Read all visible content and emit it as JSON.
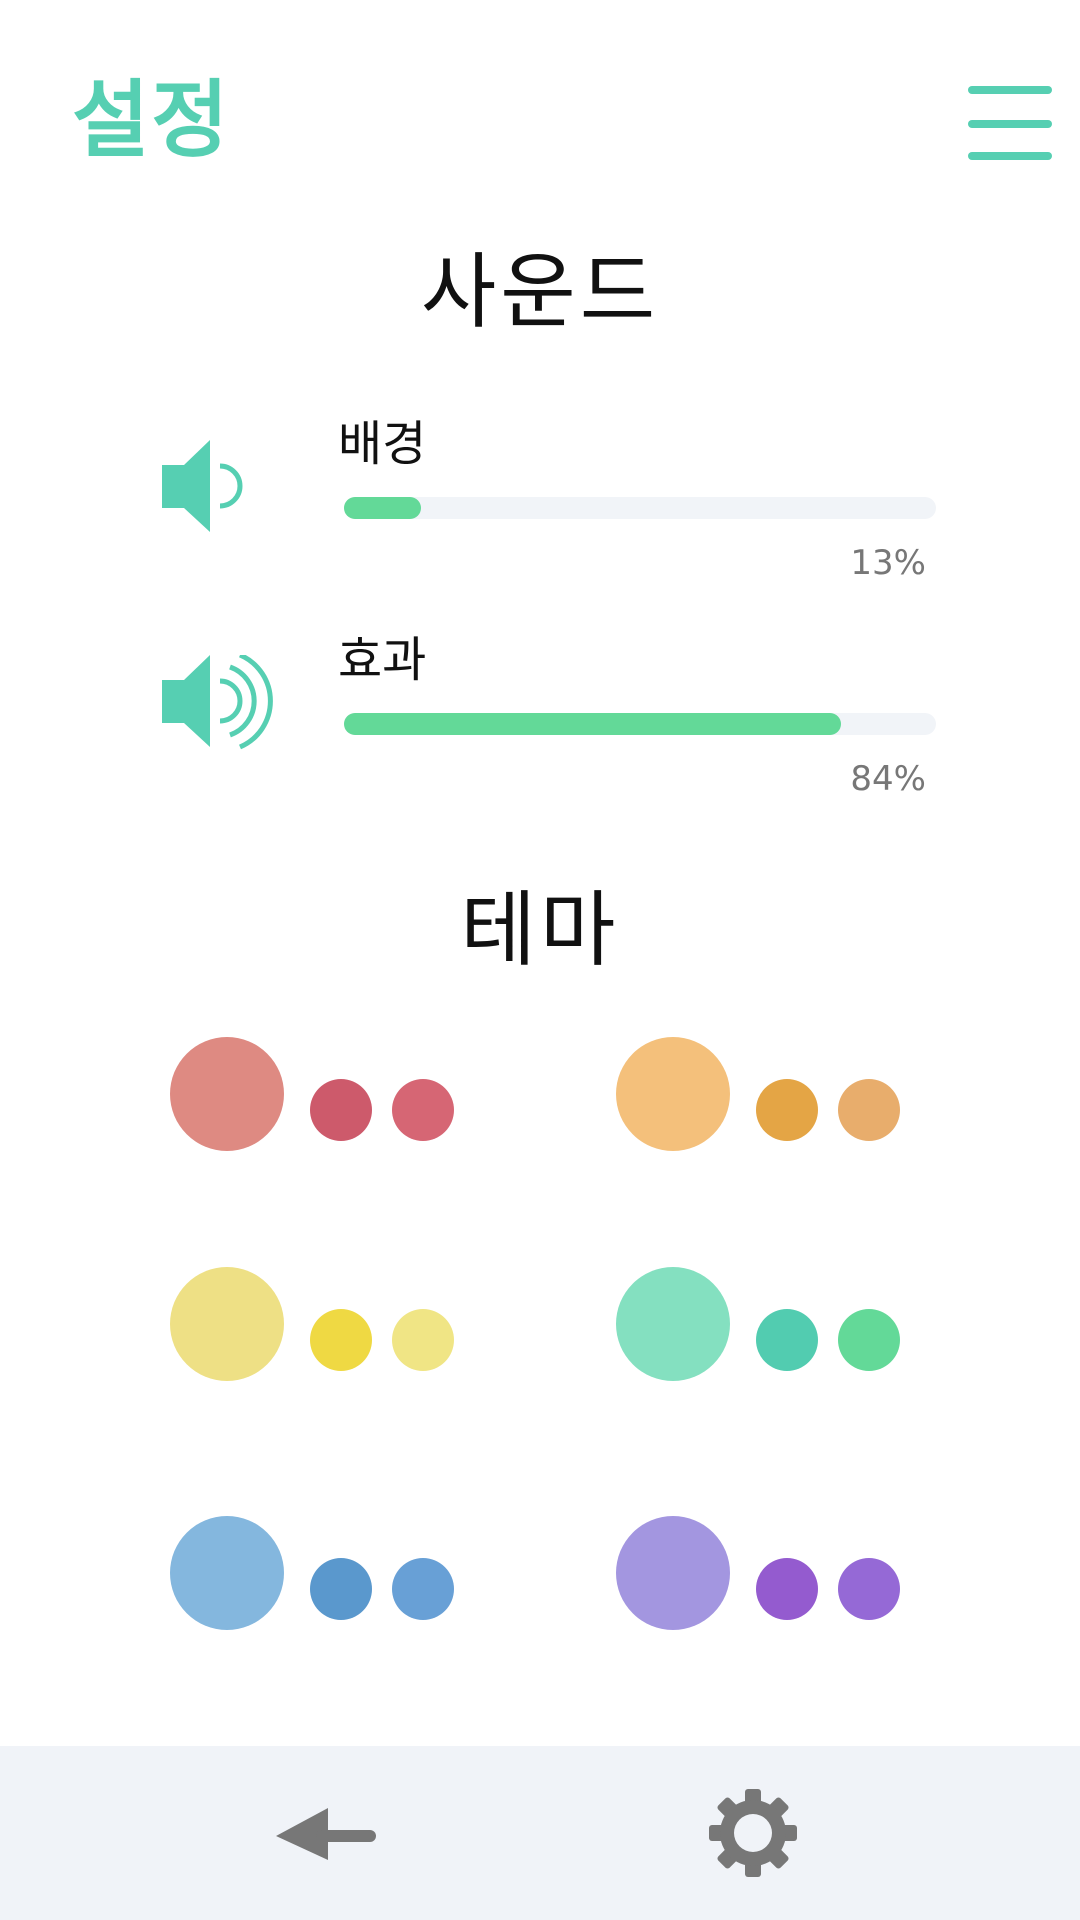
{
  "header": {
    "title": "설정",
    "menu_icon": "hamburger-menu-icon"
  },
  "sound": {
    "title": "사운드",
    "background": {
      "label": "배경",
      "value": 13,
      "value_text": "13%",
      "icon": "speaker-low-volume-icon"
    },
    "effects": {
      "label": "효과",
      "value": 84,
      "value_text": "84%",
      "icon": "speaker-high-volume-icon"
    }
  },
  "theme": {
    "title": "테마",
    "options": [
      {
        "name": "red",
        "colors": [
          "#de8a82",
          "#cd5a6b",
          "#d66674"
        ]
      },
      {
        "name": "orange",
        "colors": [
          "#f4c07b",
          "#e4a545",
          "#e8ad6c"
        ]
      },
      {
        "name": "yellow",
        "colors": [
          "#eee085",
          "#efd943",
          "#f0e585"
        ]
      },
      {
        "name": "green",
        "colors": [
          "#84e0c0",
          "#52ccb0",
          "#63d998"
        ]
      },
      {
        "name": "blue",
        "colors": [
          "#84b7de",
          "#5a98cd",
          "#68a0d6"
        ]
      },
      {
        "name": "purple",
        "colors": [
          "#a396e0",
          "#945bcf",
          "#9569d6"
        ]
      }
    ]
  },
  "colors": {
    "accent": "#56cfb2",
    "slider_fill": "#63d998",
    "slider_track": "#f1f4f8",
    "bottom_bar": "#f0f3f8",
    "nav_icon": "#777777"
  },
  "bottom_nav": {
    "back_icon": "back-arrow-icon",
    "settings_icon": "gear-icon"
  }
}
